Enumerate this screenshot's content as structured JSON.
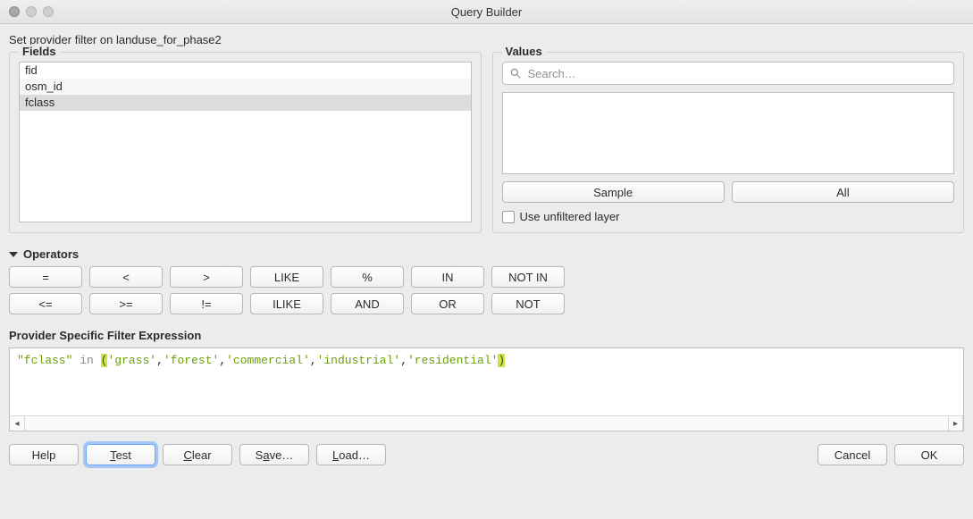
{
  "window": {
    "title": "Query Builder"
  },
  "instruction": "Set provider filter on landuse_for_phase2",
  "fields": {
    "label": "Fields",
    "items": [
      "fid",
      "osm_id",
      "fclass"
    ],
    "selected_index": 2
  },
  "values": {
    "label": "Values",
    "search_placeholder": "Search…",
    "sample_label": "Sample",
    "all_label": "All",
    "use_unfiltered_label": "Use unfiltered layer",
    "use_unfiltered_checked": false
  },
  "operators": {
    "label": "Operators",
    "row1": [
      "=",
      "<",
      ">",
      "LIKE",
      "%",
      "IN",
      "NOT IN"
    ],
    "row2": [
      "<=",
      ">=",
      "!=",
      "ILIKE",
      "AND",
      "OR",
      "NOT"
    ]
  },
  "expression": {
    "label": "Provider Specific Filter Expression",
    "tokens": [
      {
        "t": "\"fclass\"",
        "c": "str"
      },
      {
        "t": " ",
        "c": ""
      },
      {
        "t": "in",
        "c": "kw"
      },
      {
        "t": " ",
        "c": ""
      },
      {
        "t": "(",
        "c": "hl"
      },
      {
        "t": "'grass'",
        "c": "str"
      },
      {
        "t": ",",
        "c": ""
      },
      {
        "t": "'forest'",
        "c": "str"
      },
      {
        "t": ",",
        "c": ""
      },
      {
        "t": "'commercial'",
        "c": "str"
      },
      {
        "t": ",",
        "c": ""
      },
      {
        "t": "'industrial'",
        "c": "str"
      },
      {
        "t": ",",
        "c": ""
      },
      {
        "t": "'residential'",
        "c": "str"
      },
      {
        "t": ")",
        "c": "hl"
      }
    ]
  },
  "footer": {
    "help": "Help",
    "test": "Test",
    "clear": "Clear",
    "save": "Save…",
    "load": "Load…",
    "cancel": "Cancel",
    "ok": "OK"
  }
}
